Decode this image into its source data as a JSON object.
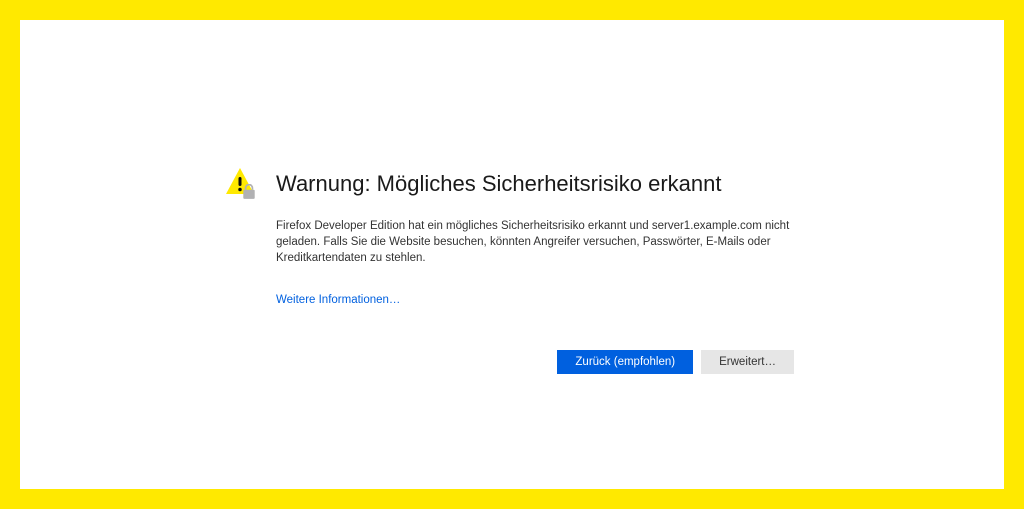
{
  "warning": {
    "title": "Warnung: Mögliches Sicherheitsrisiko erkannt",
    "body": "Firefox Developer Edition hat ein mögliches Sicherheitsrisiko erkannt und server1.example.com nicht geladen. Falls Sie die Website besuchen, könnten Angreifer versuchen, Passwörter, E-Mails oder Kreditkartendaten zu stehlen.",
    "more_info_link": "Weitere Informationen…",
    "back_button": "Zurück (empfohlen)",
    "advanced_button": "Erweitert…"
  },
  "colors": {
    "frame": "#ffe900",
    "primary_button": "#0060df",
    "link": "#0060df",
    "secondary_button": "#e6e6e6",
    "warning_triangle": "#ffe900",
    "lock_body": "#b1b1b3"
  }
}
